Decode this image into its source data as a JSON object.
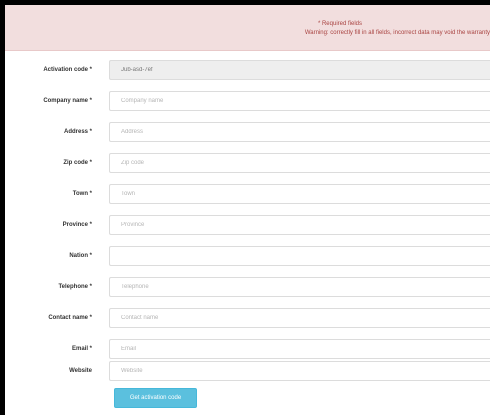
{
  "alert": {
    "line1": "* Required fields",
    "line2": "Warning: correctly fill in all fields, incorrect data may void the warranty"
  },
  "form": {
    "fields": [
      {
        "label": "Activation code *",
        "value": "Jub-asd-7ef",
        "placeholder": ""
      },
      {
        "label": "Company name *",
        "value": "",
        "placeholder": "Company name"
      },
      {
        "label": "Address *",
        "value": "",
        "placeholder": "Address"
      },
      {
        "label": "Zip code *",
        "value": "",
        "placeholder": "Zip code"
      },
      {
        "label": "Town *",
        "value": "",
        "placeholder": "Town"
      },
      {
        "label": "Province *",
        "value": "",
        "placeholder": "Province"
      },
      {
        "label": "Nation *",
        "value": "",
        "placeholder": ""
      },
      {
        "label": "Telephone *",
        "value": "",
        "placeholder": "Telephone"
      },
      {
        "label": "Contact name *",
        "value": "",
        "placeholder": "Contact name"
      },
      {
        "label": "Email *",
        "value": "",
        "placeholder": "Email"
      },
      {
        "label": "Website",
        "value": "",
        "placeholder": "Website"
      }
    ],
    "submit_label": "Get activation code"
  },
  "colors": {
    "alert_bg": "#f2dede",
    "alert_text": "#a94442",
    "button_bg": "#5bc0de"
  }
}
